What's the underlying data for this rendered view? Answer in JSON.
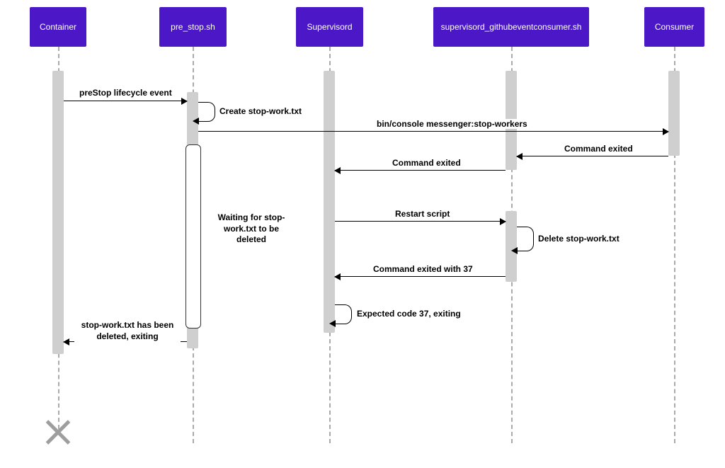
{
  "participants": {
    "container": "Container",
    "prestop": "pre_stop.sh",
    "supervisord": "Supervisord",
    "ghconsumer": "supervisord_githubeventconsumer.sh",
    "consumer": "Consumer"
  },
  "messages": {
    "prestop_event": "preStop lifecycle event",
    "create_stop": "Create stop-work.txt",
    "stop_workers": "bin/console messenger:stop-workers",
    "cmd_exited1": "Command exited",
    "cmd_exited2": "Command exited",
    "waiting": "Waiting for stop-work.txt to be deleted",
    "restart_script": "Restart script",
    "delete_stop": "Delete stop-work.txt",
    "cmd_exited_37": "Command exited with 37",
    "expected_37": "Expected code 37, exiting",
    "deleted_exiting": "stop-work.txt\nhas been deleted, exiting"
  },
  "chart_data": {
    "type": "sequence_diagram",
    "participants": [
      "Container",
      "pre_stop.sh",
      "Supervisord",
      "supervisord_githubeventconsumer.sh",
      "Consumer"
    ],
    "interactions": [
      {
        "from": "Container",
        "to": "pre_stop.sh",
        "label": "preStop lifecycle event",
        "type": "sync"
      },
      {
        "from": "pre_stop.sh",
        "to": "pre_stop.sh",
        "label": "Create stop-work.txt",
        "type": "self"
      },
      {
        "from": "pre_stop.sh",
        "to": "Consumer",
        "label": "bin/console messenger:stop-workers",
        "type": "sync"
      },
      {
        "from": "Consumer",
        "to": "supervisord_githubeventconsumer.sh",
        "label": "Command exited",
        "type": "return"
      },
      {
        "from": "supervisord_githubeventconsumer.sh",
        "to": "Supervisord",
        "label": "Command exited",
        "type": "return"
      },
      {
        "from": "pre_stop.sh",
        "to": "pre_stop.sh",
        "label": "Waiting for stop-work.txt to be deleted",
        "type": "activation_note"
      },
      {
        "from": "Supervisord",
        "to": "supervisord_githubeventconsumer.sh",
        "label": "Restart script",
        "type": "sync"
      },
      {
        "from": "supervisord_githubeventconsumer.sh",
        "to": "supervisord_githubeventconsumer.sh",
        "label": "Delete stop-work.txt",
        "type": "self"
      },
      {
        "from": "supervisord_githubeventconsumer.sh",
        "to": "Supervisord",
        "label": "Command exited with 37",
        "type": "return"
      },
      {
        "from": "Supervisord",
        "to": "Supervisord",
        "label": "Expected code 37, exiting",
        "type": "self"
      },
      {
        "from": "pre_stop.sh",
        "to": "Container",
        "label": "stop-work.txt has been deleted, exiting",
        "type": "return"
      },
      {
        "from": "Container",
        "to": "Container",
        "label": "",
        "type": "destroy"
      }
    ]
  }
}
